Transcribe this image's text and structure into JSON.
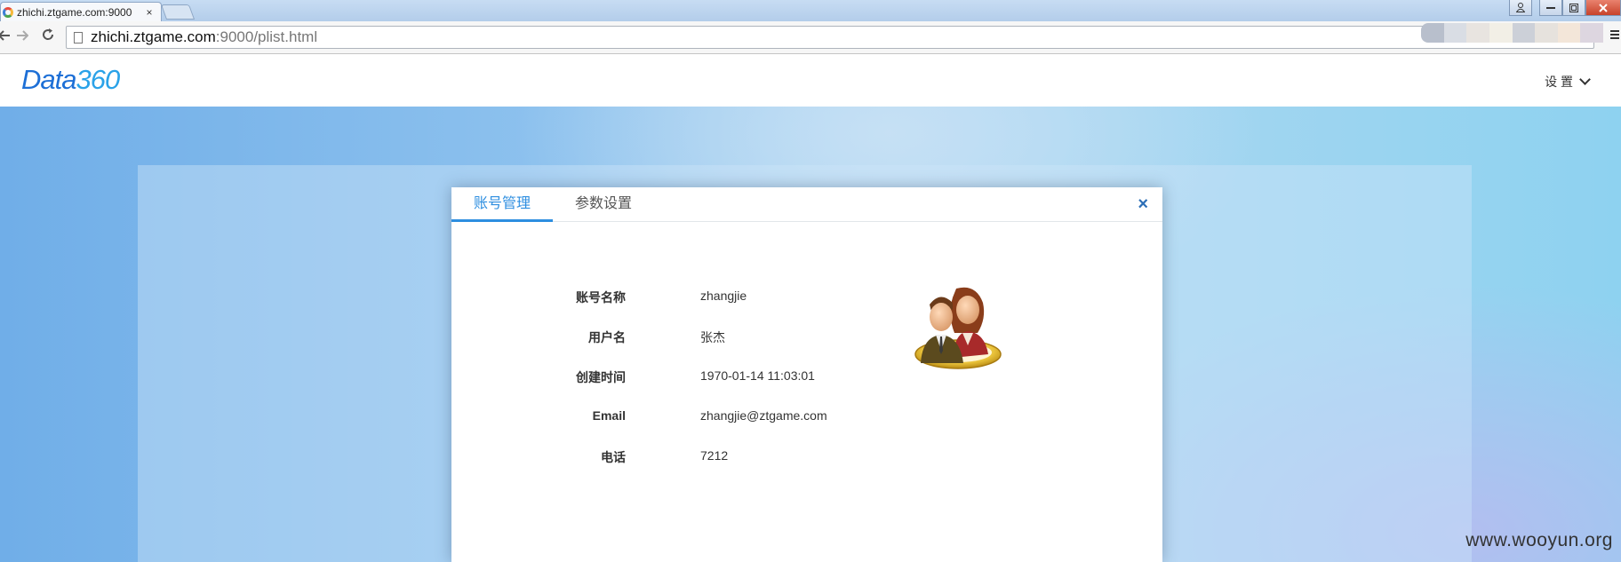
{
  "browser": {
    "tab_title": "zhichi.ztgame.com:9000",
    "tab_close": "×",
    "url_host": "zhichi.ztgame.com",
    "url_rest": ":9000/plist.html",
    "icons": [
      "favicon-icon",
      "back-icon",
      "forward-icon",
      "reload-icon",
      "page-icon",
      "menu-icon"
    ]
  },
  "header": {
    "logo_text": "Data",
    "logo_num": "360",
    "settings_label": "设 置"
  },
  "modal": {
    "tabs": [
      {
        "label": "账号管理",
        "active": true
      },
      {
        "label": "参数设置",
        "active": false
      }
    ],
    "close_label": "×",
    "fields": [
      {
        "label": "账号名称",
        "value": "zhangjie"
      },
      {
        "label": "用户名",
        "value": "张杰"
      },
      {
        "label": "创建时间",
        "value": "1970-01-14 11:03:01"
      },
      {
        "label": "Email",
        "value": "zhangjie@ztgame.com"
      },
      {
        "label": "电话",
        "value": "7212"
      }
    ]
  },
  "watermark": "www.wooyun.org",
  "colors": {
    "accent": "#2d8ee0",
    "logo": "#1d6fd6",
    "close": "#2d6fb7"
  }
}
